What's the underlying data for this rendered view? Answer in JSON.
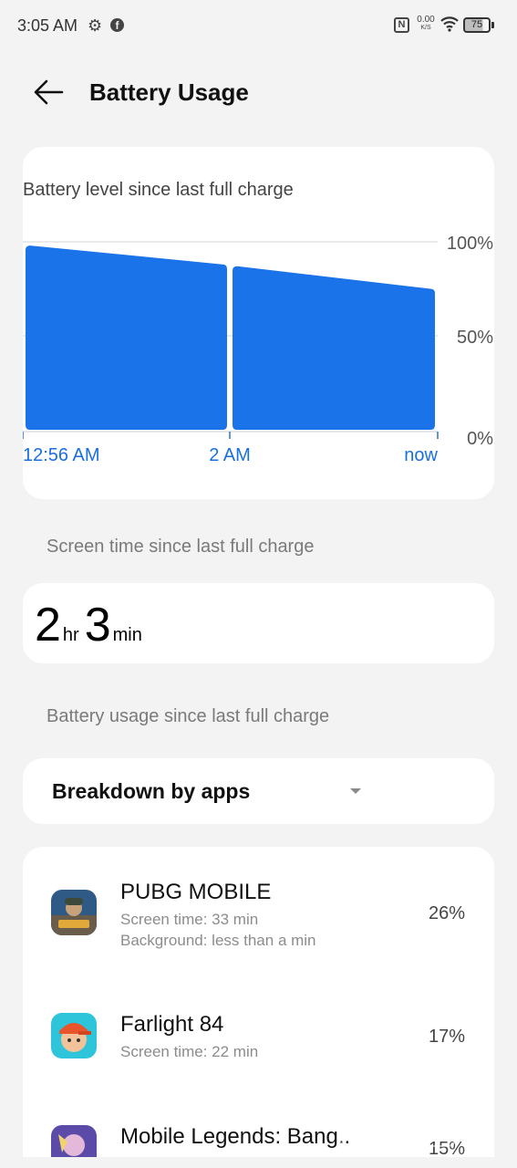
{
  "status_bar": {
    "time": "3:05 AM",
    "icons": [
      "gear-icon",
      "facebook-icon",
      "nfc-icon",
      "wifi-icon",
      "battery-icon"
    ],
    "net_speed_value": "0.00",
    "net_speed_unit": "K/S",
    "battery_level": "75"
  },
  "header": {
    "title": "Battery Usage"
  },
  "chart": {
    "heading": "Battery level since last full charge",
    "bar_color": "#1a73e8"
  },
  "chart_data": {
    "type": "area",
    "title": "Battery level since last full charge",
    "x_ticks": [
      "12:56 AM",
      "2 AM",
      "now"
    ],
    "y_ticks": [
      "100%",
      "50%",
      "0%"
    ],
    "ylim": [
      0,
      100
    ],
    "grid": true,
    "segments": [
      {
        "x": [
          "12:56 AM",
          "2 AM"
        ],
        "y": [
          98,
          88
        ]
      },
      {
        "x": [
          "2 AM",
          "now"
        ],
        "y": [
          87,
          75
        ]
      }
    ]
  },
  "screen_time": {
    "label": "Screen time since last full charge",
    "hours": "2",
    "hours_unit": "hr",
    "minutes": "3",
    "minutes_unit": "min"
  },
  "usage": {
    "label": "Battery usage since last full charge",
    "dropdown_value": "Breakdown by apps"
  },
  "apps": [
    {
      "name": "PUBG MOBILE",
      "line1": "Screen time: 33 min",
      "line2": "Background: less than a min",
      "percent": "26%"
    },
    {
      "name": "Farlight 84",
      "line1": "Screen time: 22 min",
      "line2": "",
      "percent": "17%"
    },
    {
      "name": "Mobile Legends: Bang..",
      "line1": "",
      "line2": "",
      "percent": "15%"
    }
  ]
}
